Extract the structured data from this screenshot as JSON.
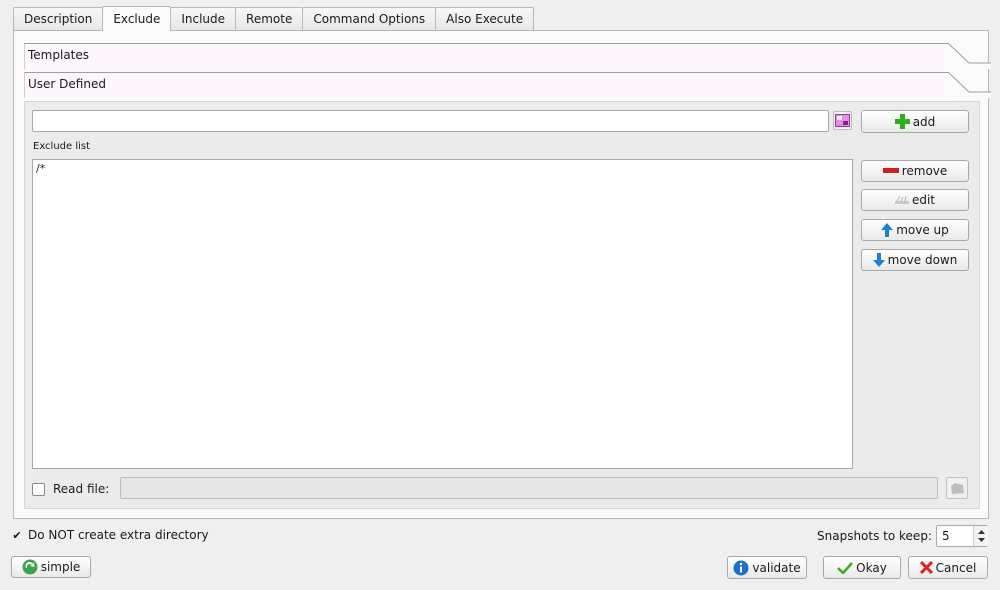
{
  "tabs": [
    {
      "label": "Description",
      "active": false
    },
    {
      "label": "Exclude",
      "active": true
    },
    {
      "label": "Include",
      "active": false
    },
    {
      "label": "Remote",
      "active": false
    },
    {
      "label": "Command Options",
      "active": false
    },
    {
      "label": "Also Execute",
      "active": false
    }
  ],
  "sections": {
    "templates_label": "Templates",
    "user_defined_label": "User Defined"
  },
  "exclude": {
    "pattern_input_value": "",
    "add_label": "add",
    "list_label": "Exclude list",
    "items": [
      "/*"
    ],
    "remove_label": "remove",
    "edit_label": "edit",
    "move_up_label": "move up",
    "move_down_label": "move down",
    "read_file_label": "Read file:",
    "read_file_checked": false,
    "read_file_value": ""
  },
  "footer": {
    "no_extra_dir_label": "Do NOT create extra directory",
    "no_extra_dir_checked": true,
    "snapshots_label": "Snapshots to keep:",
    "snapshots_value": "5",
    "simple_label": "simple",
    "validate_label": "validate",
    "okay_label": "Okay",
    "cancel_label": "Cancel"
  },
  "colors": {
    "section_bg": "#fdf6fd",
    "add_icon": "#33aa22",
    "remove_icon": "#cc2222",
    "arrow_icon": "#1e7fd6",
    "cancel_icon": "#dd2222",
    "okay_icon": "#44aa22"
  }
}
